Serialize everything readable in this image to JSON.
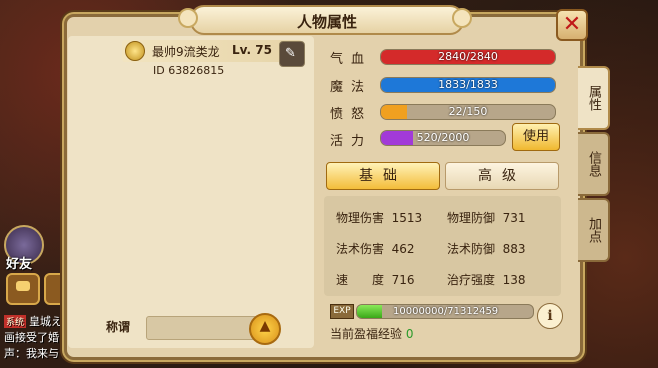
{
  "window": {
    "title": "人物属性"
  },
  "character": {
    "name": "最帅9流类龙",
    "level": "Lv. 75",
    "id": "ID 63826815",
    "title_label": "称谓"
  },
  "stats": {
    "hp": {
      "label": "气血",
      "text": "2840/2840",
      "fraction": 1.0
    },
    "mp": {
      "label": "魔法",
      "text": "1833/1833",
      "fraction": 1.0
    },
    "anger": {
      "label": "愤怒",
      "text": "22/150",
      "fraction": 0.147
    },
    "vigor": {
      "label": "活力",
      "text": "520/2000",
      "fraction": 0.26
    },
    "use_button": "使用"
  },
  "tabs": {
    "basic": "基础",
    "advanced": "高级"
  },
  "attributes": [
    {
      "label": "物理伤害",
      "value": "1513"
    },
    {
      "label": "物理防御",
      "value": "731"
    },
    {
      "label": "法术伤害",
      "value": "462"
    },
    {
      "label": "法术防御",
      "value": "883"
    },
    {
      "label": "速　　度",
      "value": "716"
    },
    {
      "label": "治疗强度",
      "value": "138"
    }
  ],
  "experience": {
    "badge": "EXP",
    "text": "10000000/71312459",
    "fraction": 0.14,
    "bless_label": "当前盈福经验",
    "bless_value": "0"
  },
  "side_tabs": [
    "属性",
    "信息",
    "加点"
  ],
  "hud": {
    "friend_label": "好友",
    "chat_tag": "系统",
    "chat_lines": [
      "皇城え",
      "画接受了婚",
      "声：我来与"
    ]
  },
  "colors": {
    "hp": "#d42a2a",
    "mp": "#1e78d8",
    "anger": "#f0a020",
    "vigor": "#a23ad8"
  }
}
